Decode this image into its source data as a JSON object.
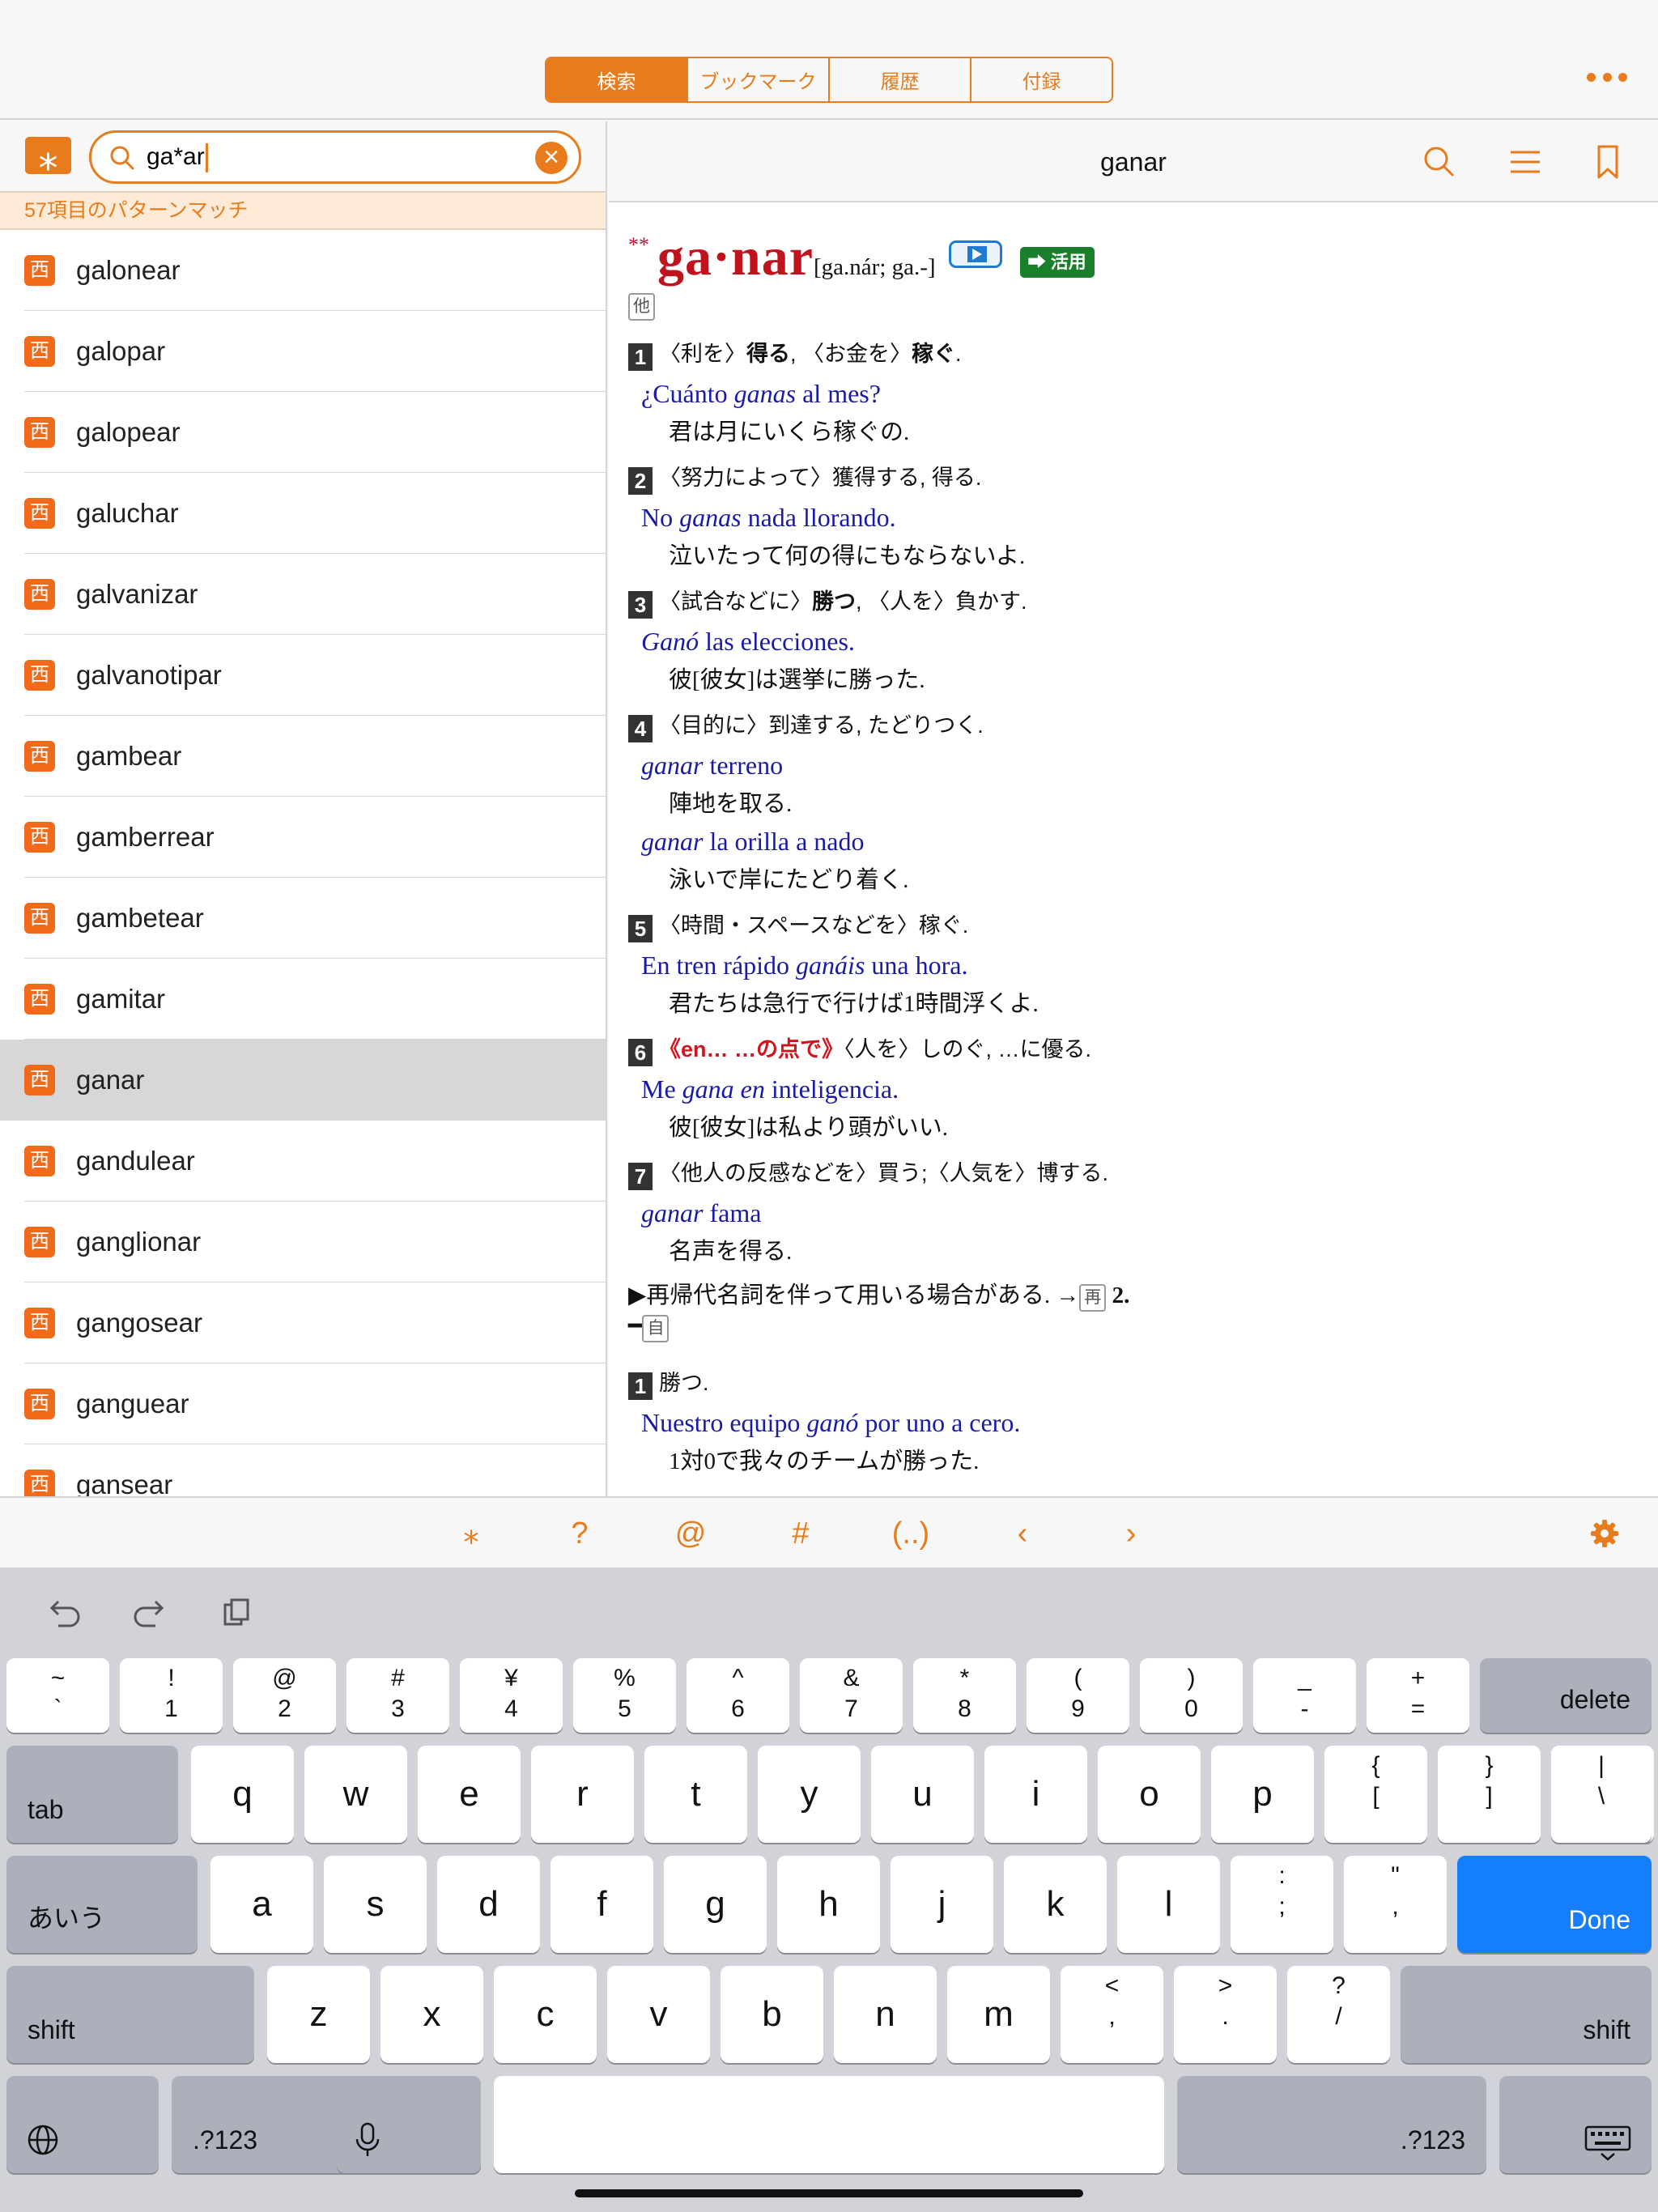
{
  "tabs": [
    {
      "label": "検索",
      "active": true
    },
    {
      "label": "ブックマーク",
      "active": false
    },
    {
      "label": "履歴",
      "active": false
    },
    {
      "label": "付録",
      "active": false
    }
  ],
  "search": {
    "value": "ga*ar",
    "match_text": "57項目のパターンマッチ"
  },
  "word_list": [
    {
      "lang": "西",
      "word": "galonear"
    },
    {
      "lang": "西",
      "word": "galopar"
    },
    {
      "lang": "西",
      "word": "galopear"
    },
    {
      "lang": "西",
      "word": "galuchar"
    },
    {
      "lang": "西",
      "word": "galvanizar"
    },
    {
      "lang": "西",
      "word": "galvanotipar"
    },
    {
      "lang": "西",
      "word": "gambear"
    },
    {
      "lang": "西",
      "word": "gamberrear"
    },
    {
      "lang": "西",
      "word": "gambetear"
    },
    {
      "lang": "西",
      "word": "gamitar"
    },
    {
      "lang": "西",
      "word": "ganar",
      "selected": true
    },
    {
      "lang": "西",
      "word": "gandulear"
    },
    {
      "lang": "西",
      "word": "ganglionar"
    },
    {
      "lang": "西",
      "word": "gangosear"
    },
    {
      "lang": "西",
      "word": "ganguear"
    },
    {
      "lang": "西",
      "word": "gansear"
    }
  ],
  "entry": {
    "title": "ganar",
    "stars": "**",
    "headword": "ga·nar",
    "pronunciation": "[ga.nár; ga.-]",
    "conjugation_label": "➡ 活用",
    "pos_transitive": "他",
    "senses": [
      {
        "num": "1",
        "def_a": "〈利を〉",
        "def_b": "得る",
        "def_c": ", 〈お金を〉",
        "def_d": "稼ぐ",
        "def_e": "."
      },
      {
        "num": "2",
        "def": "〈努力によって〉獲得する, 得る."
      },
      {
        "num": "3",
        "def_a": "〈試合などに〉",
        "def_b": "勝つ",
        "def_c": ", 〈人を〉負かす."
      },
      {
        "num": "4",
        "def": "〈目的に〉到達する, たどりつく."
      },
      {
        "num": "5",
        "def": "〈時間・スペースなどを〉稼ぐ."
      },
      {
        "num": "6",
        "def_red": "《en… …の点で》",
        "def": "〈人を〉しのぐ, …に優る."
      },
      {
        "num": "7",
        "def": "〈他人の反感などを〉買う;〈人気を〉博する."
      }
    ],
    "examples": [
      {
        "text_a": "¿Cuánto ",
        "text_i": "ganas",
        "text_b": " al mes?",
        "translation": "君は月にいくら稼ぐの."
      },
      {
        "text_a": "No ",
        "text_i": "ganas",
        "text_b": " nada llorando.",
        "translation": "泣いたって何の得にもならないよ."
      },
      {
        "text_a": "",
        "text_i": "Ganó",
        "text_b": " las elecciones.",
        "translation": "彼[彼女]は選挙に勝った."
      },
      {
        "text_a": "",
        "text_i": "ganar",
        "text_b": " terreno",
        "translation": "陣地を取る."
      },
      {
        "text_a": "",
        "text_i": "ganar",
        "text_b": " la orilla a nado",
        "translation": "泳いで岸にたどり着く."
      },
      {
        "text_a": "En tren rápido ",
        "text_i": "ganáis",
        "text_b": " una hora.",
        "translation": "君たちは急行で行けば1時間浮くよ."
      },
      {
        "text_a": "Me ",
        "text_i": "gana en",
        "text_b": " inteligencia.",
        "translation": "彼[彼女]は私より頭がいい."
      },
      {
        "text_a": "",
        "text_i": "ganar",
        "text_b": " fama",
        "translation": "名声を得る."
      },
      {
        "text_a": "Nuestro equipo ",
        "text_i": "ganó",
        "text_b": " por uno a cero.",
        "translation": "1対0で我々のチームが勝った."
      }
    ],
    "note": "▶再帰代名詞を伴って用いる場合がある. →",
    "note_box": "再",
    "note_num": "2.",
    "dash": "━",
    "pos_intransitive": "自",
    "intrans_sense_num": "1",
    "intrans_sense_def": "勝つ."
  },
  "accessory": [
    "⁎",
    "?",
    "@",
    "#",
    "(..)",
    "‹",
    "›"
  ],
  "keyboard": {
    "row1": [
      {
        "top": "~",
        "bottom": "`"
      },
      {
        "top": "!",
        "bottom": "1"
      },
      {
        "top": "@",
        "bottom": "2"
      },
      {
        "top": "#",
        "bottom": "3"
      },
      {
        "top": "¥",
        "bottom": "4"
      },
      {
        "top": "%",
        "bottom": "5"
      },
      {
        "top": "^",
        "bottom": "6"
      },
      {
        "top": "&",
        "bottom": "7"
      },
      {
        "top": "*",
        "bottom": "8"
      },
      {
        "top": "(",
        "bottom": "9"
      },
      {
        "top": ")",
        "bottom": "0"
      },
      {
        "top": "_",
        "bottom": "-"
      },
      {
        "top": "+",
        "bottom": "="
      }
    ],
    "delete": "delete",
    "tab": "tab",
    "row2": [
      "q",
      "w",
      "e",
      "r",
      "t",
      "y",
      "u",
      "i",
      "o",
      "p"
    ],
    "row2_sym": [
      {
        "top": "{",
        "bottom": "["
      },
      {
        "top": "}",
        "bottom": "]"
      },
      {
        "top": "|",
        "bottom": "\\"
      }
    ],
    "kana": "あいう",
    "row3": [
      "a",
      "s",
      "d",
      "f",
      "g",
      "h",
      "j",
      "k",
      "l"
    ],
    "row3_sym": [
      {
        "top": ":",
        "bottom": ";"
      },
      {
        "top": "\"",
        "bottom": ","
      }
    ],
    "done": "Done",
    "shift": "shift",
    "row4": [
      "z",
      "x",
      "c",
      "v",
      "b",
      "n",
      "m"
    ],
    "row4_sym": [
      {
        "top": "<",
        "bottom": ","
      },
      {
        "top": ">",
        "bottom": "."
      },
      {
        "top": "?",
        "bottom": "/"
      }
    ],
    "num_label": ".?123"
  },
  "colors": {
    "accent": "#e87b1c",
    "headword": "#c0131e",
    "example": "#1a1aa6",
    "done": "#147efb",
    "conj": "#1a7f2a"
  }
}
